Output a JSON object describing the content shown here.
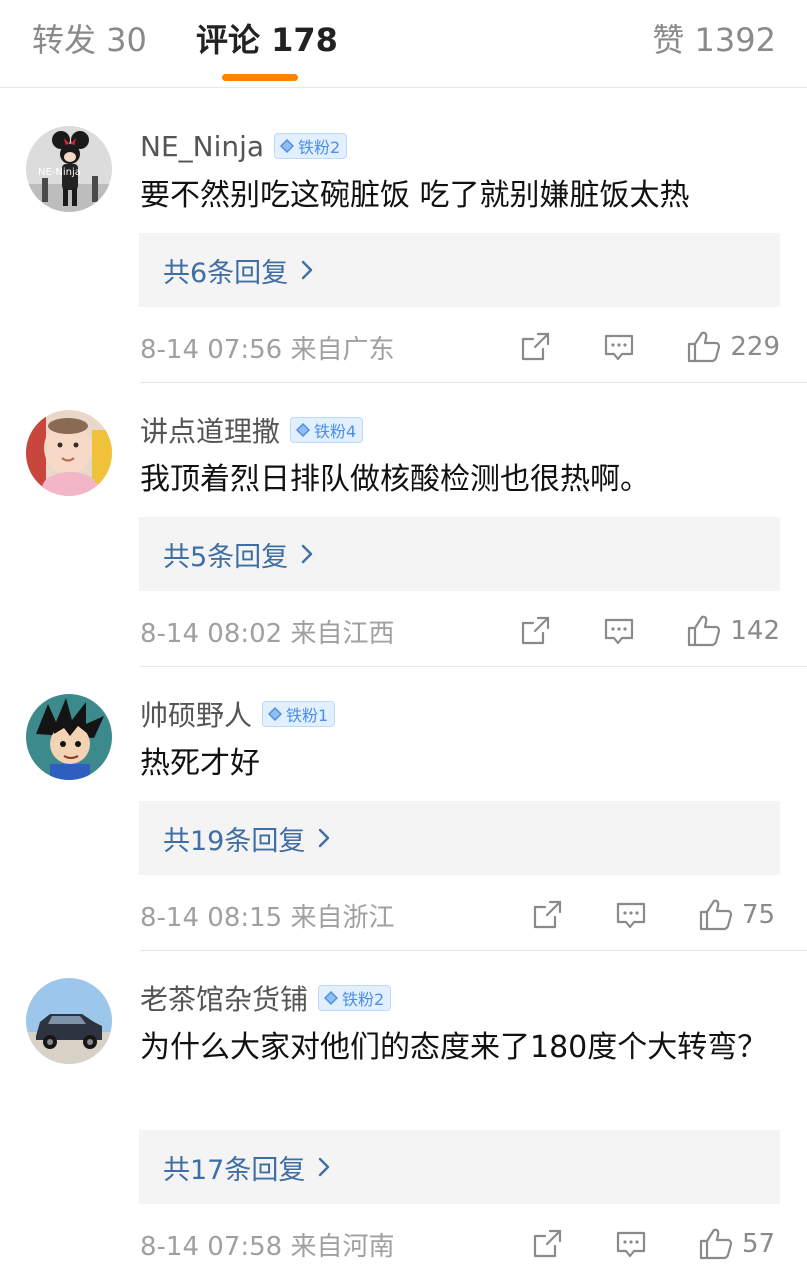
{
  "tabs": {
    "reposts": "转发 30",
    "comments": "评论 178",
    "likes": "赞 1392"
  },
  "colors": {
    "accent_underline": "#ff8200",
    "link_blue": "#3f6ea5",
    "badge_blue": "#4c8fe6"
  },
  "comments": [
    {
      "username": "NE_Ninja",
      "badge": "铁粉2",
      "text": "要不然别吃这碗脏饭 吃了就别嫌脏饭太热",
      "replies": "共6条回复",
      "meta": "8-14 07:56  来自广东",
      "likes": "229",
      "avatar_icon": "minnie-guitar-avatar"
    },
    {
      "username": "讲点道理撒",
      "badge": "铁粉4",
      "text": "我顶着烈日排队做核酸检测也很热啊。",
      "replies": "共5条回复",
      "meta": "8-14 08:02  来自江西",
      "likes": "142",
      "avatar_icon": "baby-photo-avatar"
    },
    {
      "username": "帅硕野人",
      "badge": "铁粉1",
      "text": "热死才好",
      "replies": "共19条回复",
      "meta": "8-14 08:15  来自浙江",
      "likes": "75",
      "avatar_icon": "cartoon-boy-avatar"
    },
    {
      "username": "老茶馆杂货铺",
      "badge": "铁粉2",
      "text": "为什么大家对他们的态度来了180度个大转弯？",
      "replies": "共17条回复",
      "meta": "8-14 07:58  来自河南",
      "likes": "57",
      "avatar_icon": "suv-car-avatar"
    }
  ]
}
